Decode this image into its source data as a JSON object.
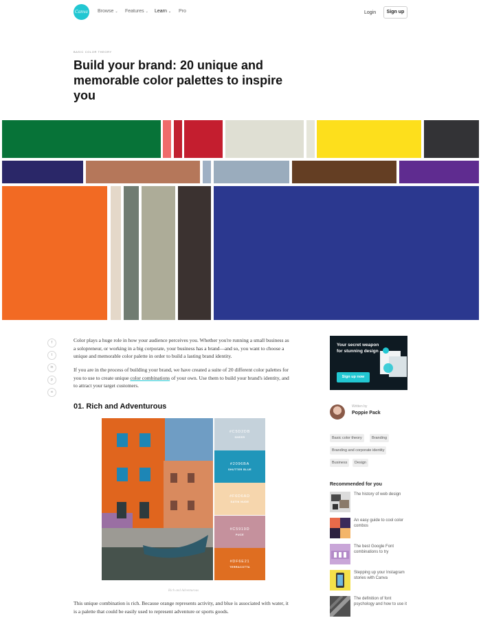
{
  "nav": {
    "logo_text": "Canva",
    "links": [
      {
        "label": "Browse",
        "chevron": "⌄"
      },
      {
        "label": "Features",
        "chevron": "⌄"
      },
      {
        "label": "Learn",
        "chevron": "⌄"
      },
      {
        "label": "Pro",
        "chevron": ""
      }
    ],
    "login": "Login",
    "signup": "Sign up"
  },
  "header": {
    "kicker": "BASIC COLOR THEORY",
    "title": "Build your brand: 20 unique and memorable color palettes to inspire you"
  },
  "mosaic_colors": {
    "green": "#077338",
    "pink": "#f06b6b",
    "crimson": "#c1202f",
    "red": "#c41e2f",
    "cream": "#dfdfd3",
    "ivory": "#e6e6da",
    "yellow": "#fddf1c",
    "charcoal": "#333336",
    "navy": "#2a2768",
    "copper": "#b5775a",
    "slate_sliver": "#9fb0c4",
    "slate": "#9aacbd",
    "brown": "#643e23",
    "purple": "#5f2c90",
    "orange": "#f26a23",
    "beige": "#e4d8c9",
    "sage": "#707c72",
    "khaki": "#adac98",
    "espresso": "#3b3230",
    "blue": "#2b388f"
  },
  "social_icons": [
    "facebook-icon",
    "twitter-icon",
    "linkedin-icon",
    "pinterest-icon",
    "link-icon"
  ],
  "social_glyphs": [
    "f",
    "t",
    "in",
    "p",
    "∞"
  ],
  "article": {
    "para1": "Color plays a huge role in how your audience perceives you. Whether you're running a small business as a solopreneur, or working in a big corporate, your business has a brand—and so, you want to choose a unique and memorable color palette in order to build a lasting brand identity.",
    "para2_before": "If you are in the process of building your brand, we have created a suite of 20 different color palettes for you to use to create unique ",
    "para2_link": "color combinations",
    "para2_after": " of your own. Use them to build your brand's identity, and to attract your target customers.",
    "section_title": "01. Rich and Adventurous",
    "caption": "Rich and Adventurous",
    "para3": "This unique combination is rich. Because orange represents activity, and blue is associated with water, it is a palette that could be easily used to represent adventure or sports goods."
  },
  "palette": [
    {
      "hex": "#C5D2DB",
      "name": "SHEER",
      "color": "#c5d2db"
    },
    {
      "hex": "#2096BA",
      "name": "SHUTTER BLUE",
      "color": "#2096ba"
    },
    {
      "hex": "#F6D6AD",
      "name": "SATIN NUDE",
      "color": "#f6d6ad"
    },
    {
      "hex": "#C5919D",
      "name": "PUCE",
      "color": "#c5919d"
    },
    {
      "hex": "#DF6E21",
      "name": "TERRACOTTA",
      "color": "#df6e21"
    }
  ],
  "sidebar": {
    "ad_text": "Your secret weapon for stunning design",
    "ad_button": "Sign up now",
    "written_by": "Written by",
    "author": "Poppie Pack",
    "tags": [
      "Basic color theory",
      "Branding",
      "Branding and corporate identity",
      "Business",
      "Design"
    ],
    "recommended_title": "Recommended for you",
    "recommended": [
      "The history of web design",
      "An easy guide to cool color combos",
      "The best Google Font combinations to try",
      "Stepping up your Instagram stories with Canva",
      "The definition of font psychology and how to use it"
    ]
  }
}
